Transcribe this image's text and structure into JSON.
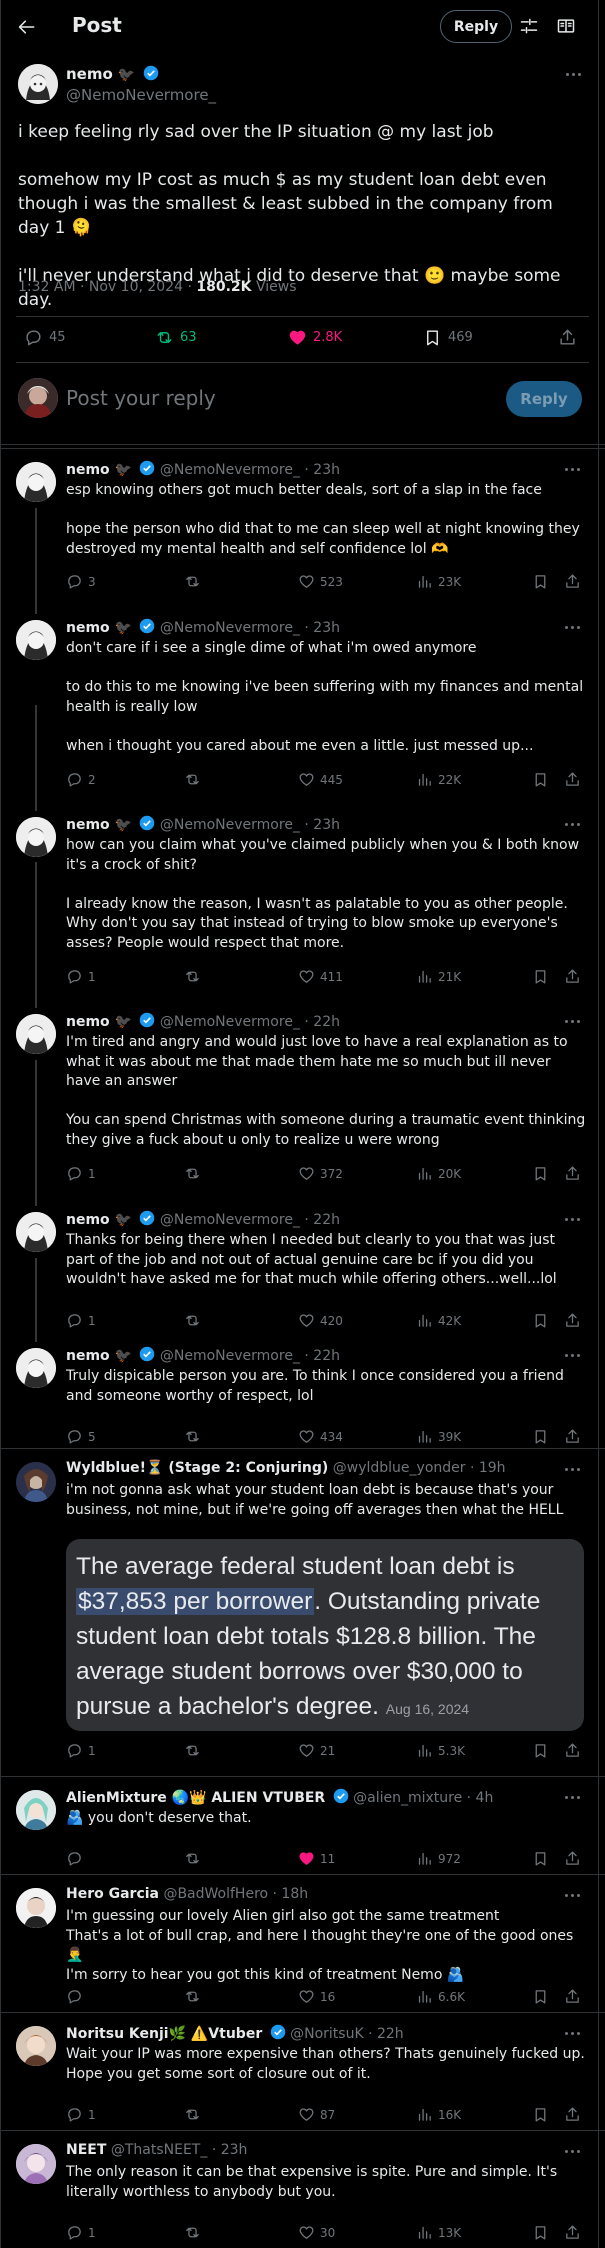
{
  "header": {
    "title": "Post",
    "reply_label": "Reply"
  },
  "main_post": {
    "author_name": "nemo",
    "author_emoji": "🐦‍⬛",
    "author_handle": "@NemoNevermore_",
    "text": "i keep feeling rly sad over the IP situation @ my last job\n\nsomehow my IP cost as much $ as my student loan debt even though i was the smallest & least subbed in the company from day 1 🫠\n\ni'll never understand what i did to deserve that 🙂 maybe some day.",
    "timestamp": "1:32 AM · Nov 10, 2024 · ",
    "views_count": "180.2K",
    "views_label": " Views",
    "replies": "45",
    "reposts": "63",
    "likes": "2.8K",
    "bookmarks": "469"
  },
  "composer": {
    "placeholder": "Post your reply",
    "button_label": "Reply"
  },
  "colors": {
    "background": "#000000",
    "text": "#e7e9ea",
    "muted": "#71767b",
    "border": "#2f3336",
    "accent_blue": "#1d9bf0",
    "repost_green": "#00ba7c",
    "like_pink": "#f91880"
  },
  "replies": [
    {
      "name": "nemo 🐦‍⬛",
      "handle": "@NemoNevermore_ · 23h",
      "text": "esp knowing others got much better deals, sort of a slap in the face\n\nhope the person who did that to me can sleep well at night knowing they destroyed my mental health and self confidence lol 🫶",
      "replies": "3",
      "reposts": "",
      "likes": "523",
      "views": "23K"
    },
    {
      "name": "nemo 🐦‍⬛",
      "handle": "@NemoNevermore_ · 23h",
      "text": "don't care if i see a single dime of what i'm owed anymore\n\nto do this to me knowing i've been suffering with my finances and mental health is really low\n\nwhen i thought you cared about me even a little. just messed up...",
      "replies": "2",
      "reposts": "",
      "likes": "445",
      "views": "22K"
    },
    {
      "name": "nemo 🐦‍⬛",
      "handle": "@NemoNevermore_ · 23h",
      "text": "how can you claim what you've claimed publicly when you & I both know it's a crock of shit?\n\nI already know the reason, I wasn't as palatable to you as other people. Why don't you say that instead of trying to blow smoke up everyone's asses? People would respect that more.",
      "replies": "1",
      "reposts": "",
      "likes": "411",
      "views": "21K"
    },
    {
      "name": "nemo 🐦‍⬛",
      "handle": "@NemoNevermore_ · 22h",
      "text": "I'm tired and angry and would just love to have a real explanation as to what it was about me that made them hate me so much but ill never have an answer\n\nYou can spend Christmas with someone during a traumatic event thinking they give a fuck about u only to realize u were wrong",
      "replies": "1",
      "reposts": "",
      "likes": "372",
      "views": "20K"
    },
    {
      "name": "nemo 🐦‍⬛",
      "handle": "@NemoNevermore_ · 22h",
      "text": "Thanks for being there when I needed but clearly to you that was just part of the job and not out of actual genuine care bc if you did you wouldn't have asked me for that much while offering others...well...lol",
      "replies": "1",
      "reposts": "",
      "likes": "420",
      "views": "42K"
    },
    {
      "name": "nemo 🐦‍⬛",
      "handle": "@NemoNevermore_ · 22h",
      "text": "Truly dispicable person you are. To think I once considered you a friend and someone worthy of respect, lol",
      "replies": "5",
      "reposts": "",
      "likes": "434",
      "views": "39K"
    },
    {
      "name": "Wyldblue!⏳ (Stage 2: Conjuring)",
      "handle": "@wyldblue_yonder · 19h",
      "text": "i'm not gonna ask what your student loan debt is because that's your business, not mine, but if we're going off averages then what the HELL",
      "replies": "1",
      "reposts": "",
      "likes": "21",
      "views": "5.3K"
    },
    {
      "name": "AlienMixture 🌏👑 ALIEN VTUBER",
      "handle": "@alien_mixture · 4h",
      "text": "🫂 you don't deserve that.",
      "replies": "",
      "reposts": "",
      "likes": "11",
      "views": "972"
    },
    {
      "name": "Hero Garcia",
      "handle": "@BadWolfHero · 18h",
      "text": "I'm guessing our lovely Alien girl also got the same treatment\nThat's a lot of bull crap, and here I thought they're one of the good ones 🤦‍♂️\nI'm sorry to hear you got this kind of treatment Nemo 🫂",
      "replies": "",
      "reposts": "",
      "likes": "16",
      "views": "6.6K"
    },
    {
      "name": "Noritsu Kenji🌿 ⚠️Vtuber",
      "handle": "@NoritsuK · 22h",
      "text": "Wait your IP was more expensive than others? Thats genuinely fucked up. Hope you get some sort of closure out of it.",
      "replies": "1",
      "reposts": "",
      "likes": "87",
      "views": "16K"
    },
    {
      "name": "NEET",
      "handle": "@ThatsNEET_ · 23h",
      "text": "The only reason it can be that expensive is spite. Pure and simple. It's literally worthless to anybody but you.",
      "replies": "1",
      "reposts": "",
      "likes": "30",
      "views": "13K"
    }
  ],
  "quote_card": {
    "text_before": "The average federal student loan debt is ",
    "highlight": "$37,853 per borrower",
    "text_after": ". Outstanding private student loan debt totals $128.8 billion. The average student borrows over $30,000 to pursue a bachelor's degree. ",
    "date": "Aug 16, 2024"
  }
}
